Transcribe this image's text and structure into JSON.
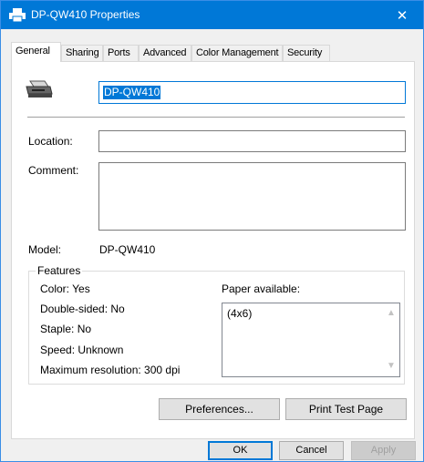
{
  "window": {
    "title": "DP-QW410 Properties",
    "accent_color": "#0078d7",
    "close_symbol": "✕"
  },
  "tabs": [
    {
      "label": "General",
      "active": true
    },
    {
      "label": "Sharing",
      "active": false
    },
    {
      "label": "Ports",
      "active": false
    },
    {
      "label": "Advanced",
      "active": false
    },
    {
      "label": "Color Management",
      "active": false
    },
    {
      "label": "Security",
      "active": false
    }
  ],
  "general": {
    "printer_name": "DP-QW410",
    "location_label": "Location:",
    "location_value": "",
    "comment_label": "Comment:",
    "comment_value": "",
    "model_label": "Model:",
    "model_value": "DP-QW410"
  },
  "features": {
    "title": "Features",
    "color": "Color: Yes",
    "double_sided": "Double-sided: No",
    "staple": "Staple: No",
    "speed": "Speed: Unknown",
    "max_resolution": "Maximum resolution: 300 dpi",
    "paper_available_label": "Paper available:",
    "paper_items": [
      "(4x6)"
    ]
  },
  "buttons": {
    "preferences": "Preferences...",
    "print_test_page": "Print Test Page",
    "ok": "OK",
    "cancel": "Cancel",
    "apply": "Apply"
  }
}
